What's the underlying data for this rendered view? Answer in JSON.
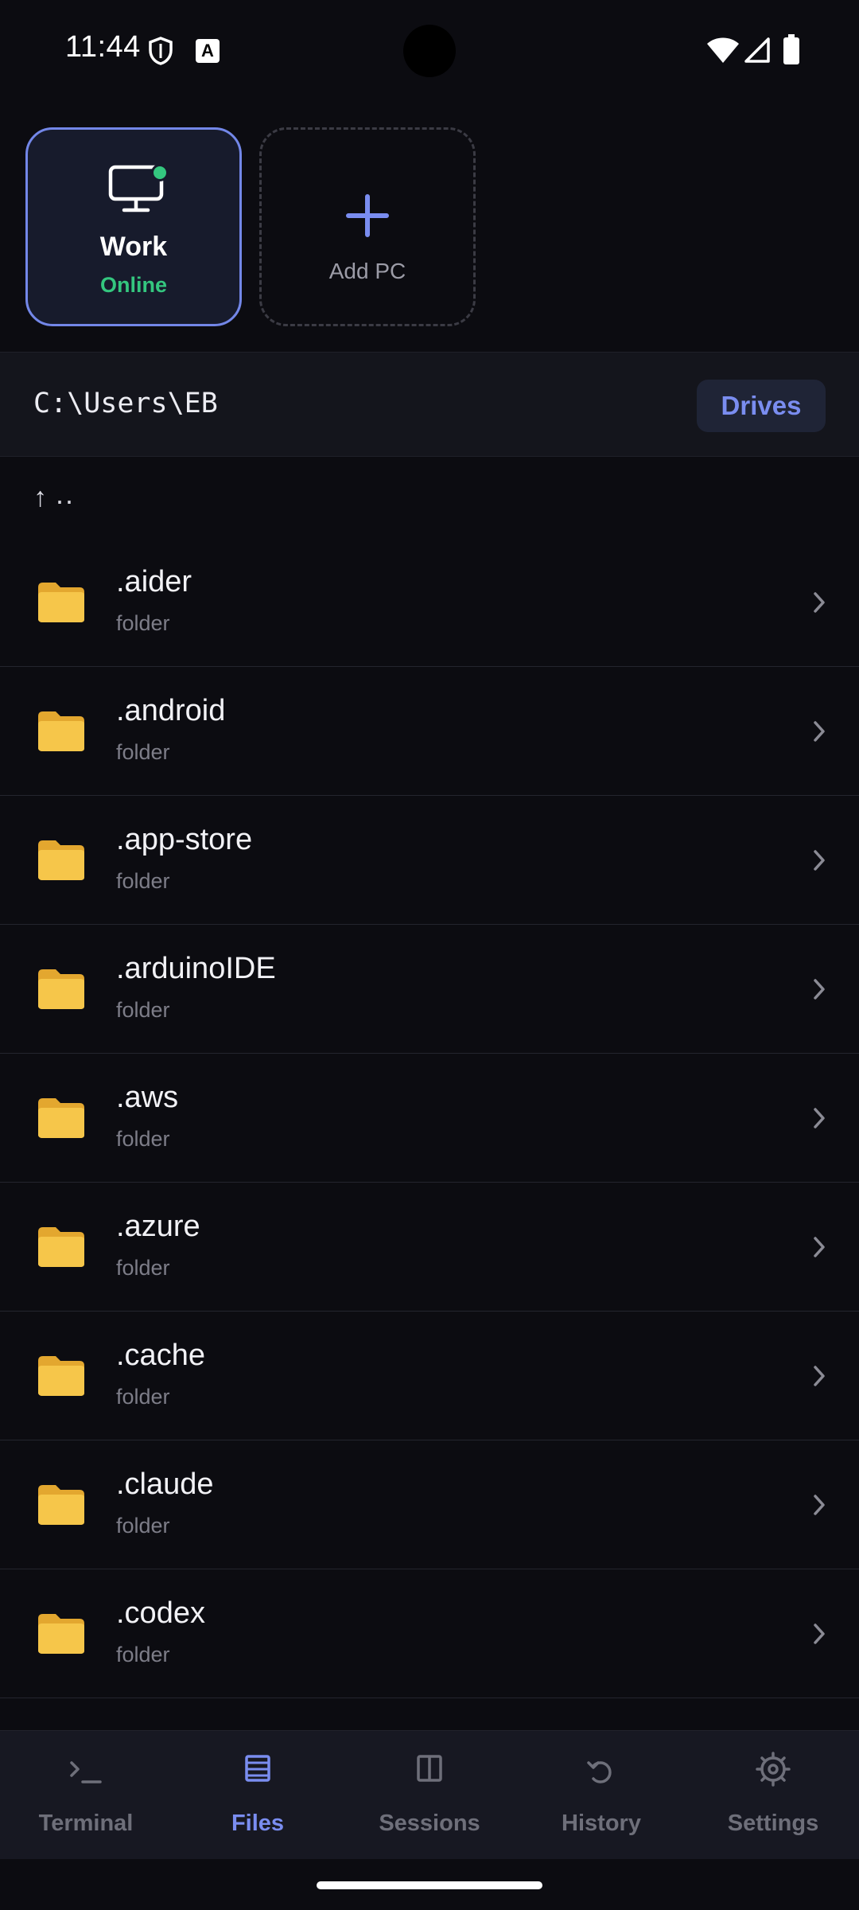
{
  "status_bar": {
    "time": "11:44",
    "a_badge": "A",
    "icons": [
      "shield-icon",
      "text-a-icon",
      "wifi-icon",
      "signal-icon",
      "battery-icon"
    ]
  },
  "pcs": {
    "work": {
      "name": "Work",
      "status": "Online"
    },
    "add": {
      "label": "Add PC"
    }
  },
  "path_bar": {
    "path": "C:\\Users\\EB",
    "drives_label": "Drives"
  },
  "parent": {
    "arrow": "↑",
    "label": ".."
  },
  "files": [
    {
      "name": ".aider",
      "type": "folder"
    },
    {
      "name": ".android",
      "type": "folder"
    },
    {
      "name": ".app-store",
      "type": "folder"
    },
    {
      "name": ".arduinoIDE",
      "type": "folder"
    },
    {
      "name": ".aws",
      "type": "folder"
    },
    {
      "name": ".azure",
      "type": "folder"
    },
    {
      "name": ".cache",
      "type": "folder"
    },
    {
      "name": ".claude",
      "type": "folder"
    },
    {
      "name": ".codex",
      "type": "folder"
    }
  ],
  "nav": [
    {
      "label": "Terminal",
      "icon": "terminal-icon",
      "active": false
    },
    {
      "label": "Files",
      "icon": "files-icon",
      "active": true
    },
    {
      "label": "Sessions",
      "icon": "sessions-icon",
      "active": false
    },
    {
      "label": "History",
      "icon": "history-icon",
      "active": false
    },
    {
      "label": "Settings",
      "icon": "settings-icon",
      "active": false
    }
  ],
  "colors": {
    "background": "#0c0c11",
    "accent": "#7a8df0",
    "online": "#34c77f",
    "folder": "#f6c64a"
  }
}
